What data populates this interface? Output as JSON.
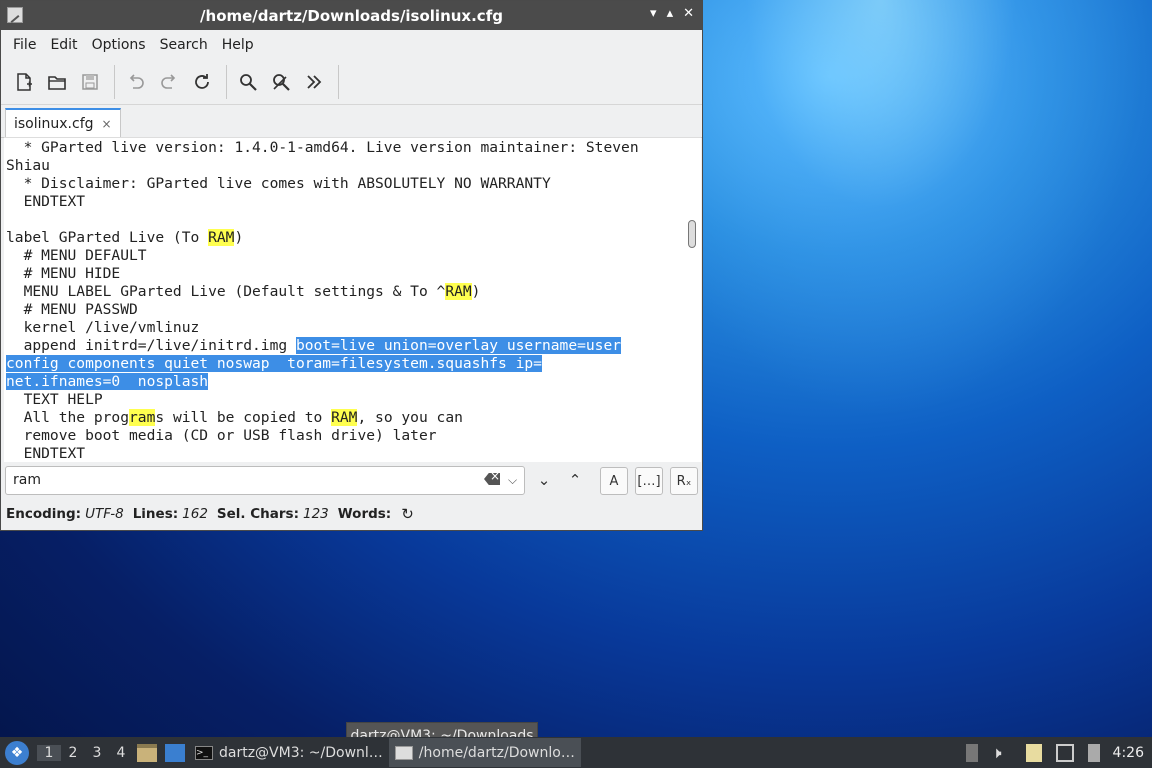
{
  "window": {
    "title": "/home/dartz/Downloads/isolinux.cfg",
    "controls": [
      "▾",
      "▴",
      "✕"
    ]
  },
  "menu": [
    "File",
    "Edit",
    "Options",
    "Search",
    "Help"
  ],
  "tab": {
    "label": "isolinux.cfg",
    "close": "×"
  },
  "editor": {
    "lines": [
      [
        {
          "t": "  * GParted live version: 1.4.0-1-amd64. Live version maintainer: Steven"
        }
      ],
      [
        {
          "t": "Shiau"
        }
      ],
      [
        {
          "t": "  * Disclaimer: GParted live comes with ABSOLUTELY NO WARRANTY"
        }
      ],
      [
        {
          "t": "  ENDTEXT"
        }
      ],
      [
        {
          "t": ""
        }
      ],
      [
        {
          "t": "label GParted Live (To "
        },
        {
          "t": "RAM",
          "c": "hl"
        },
        {
          "t": ")"
        }
      ],
      [
        {
          "t": "  # MENU DEFAULT"
        }
      ],
      [
        {
          "t": "  # MENU HIDE"
        }
      ],
      [
        {
          "t": "  MENU LABEL GParted Live (Default settings & To ^"
        },
        {
          "t": "RAM",
          "c": "hl"
        },
        {
          "t": ")"
        }
      ],
      [
        {
          "t": "  # MENU PASSWD"
        }
      ],
      [
        {
          "t": "  kernel /live/vmlinuz"
        }
      ],
      [
        {
          "t": "  append initrd=/live/initrd.img "
        },
        {
          "t": "boot=live union=overlay username=user",
          "c": "sel"
        }
      ],
      [
        {
          "t": "config components quiet noswap  toram=filesystem.squashfs ip=",
          "c": "sel"
        }
      ],
      [
        {
          "t": "net.ifnames=0  nosplash",
          "c": "sel"
        }
      ],
      [
        {
          "t": "  TEXT HELP"
        }
      ],
      [
        {
          "t": "  All the prog"
        },
        {
          "t": "ram",
          "c": "hl"
        },
        {
          "t": "s will be copied to "
        },
        {
          "t": "RAM",
          "c": "hl"
        },
        {
          "t": ", so you can"
        }
      ],
      [
        {
          "t": "  remove boot media (CD or USB flash drive) later"
        }
      ],
      [
        {
          "t": "  ENDTEXT"
        }
      ]
    ]
  },
  "find": {
    "value": "ram",
    "next": "⌄",
    "prev": "⌃",
    "match_case": "A",
    "whole_word": "[…]",
    "regex": "Rₓ"
  },
  "status": {
    "encoding_label": "Encoding:",
    "encoding_value": "UTF-8",
    "lines_label": "Lines:",
    "lines_value": "162",
    "sel_label": "Sel. Chars:",
    "sel_value": "123",
    "words_label": "Words:"
  },
  "tooltip": "dartz@VM3: ~/Downloads",
  "taskbar": {
    "workspaces": [
      "1",
      "2",
      "3",
      "4"
    ],
    "tasks": [
      "dartz@VM3: ~/Downl…",
      "/home/dartz/Downlo…"
    ],
    "clock": "4:26"
  }
}
